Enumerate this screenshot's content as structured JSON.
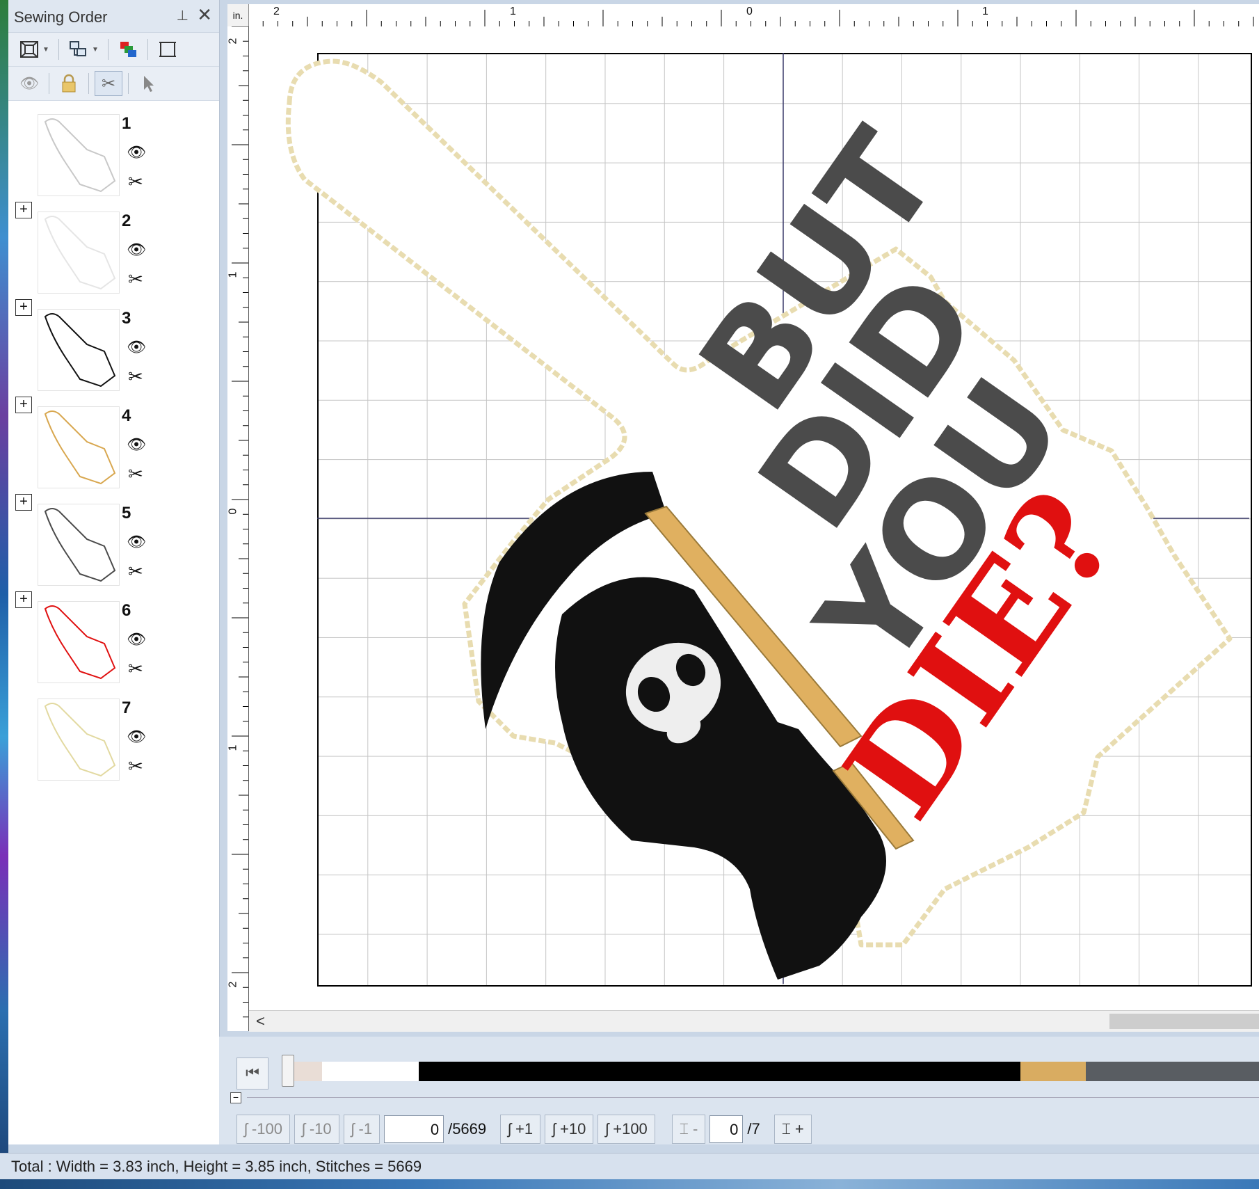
{
  "panel": {
    "title": "Sewing Order",
    "pin_icon": "pin-icon",
    "close_icon": "close-icon"
  },
  "toolbar": {
    "row1": [
      "fit-to-view-icon",
      "group-icon",
      "color-order-icon",
      "hoop-icon"
    ],
    "row2": [
      "visibility-icon",
      "lock-icon",
      "needle-icon",
      "select-arrow-icon"
    ]
  },
  "sewing_items": [
    {
      "num": "1",
      "expandable": false,
      "thumb_color": "#c8c8c8"
    },
    {
      "num": "2",
      "expandable": true,
      "thumb_color": "#e5e5e5"
    },
    {
      "num": "3",
      "expandable": true,
      "thumb_color": "#111111"
    },
    {
      "num": "4",
      "expandable": true,
      "thumb_color": "#d8a74f"
    },
    {
      "num": "5",
      "expandable": true,
      "thumb_color": "#4a4a4a"
    },
    {
      "num": "6",
      "expandable": true,
      "thumb_color": "#e01010"
    },
    {
      "num": "7",
      "expandable": false,
      "thumb_color": "#e2d9a0"
    }
  ],
  "ruler": {
    "unit": "in.",
    "top_labels": [
      "2",
      "1",
      "0",
      "1"
    ],
    "left_labels": [
      "2",
      "1",
      "0",
      "1",
      "2"
    ]
  },
  "design": {
    "line1": "BUT",
    "line2": "DID",
    "line3": "YOU",
    "line4": "DIE?",
    "colors": {
      "outline": "#e8dcb0",
      "text_gray": "#4b4b4b",
      "text_red": "#e01010",
      "cloak": "#111111",
      "handle": "#e0b060",
      "skull": "#eeeeee"
    }
  },
  "player": {
    "color_segments": [
      {
        "color": "#e9ddd6",
        "weight": 8
      },
      {
        "color": "#ffffff",
        "weight": 28
      },
      {
        "color": "#000000",
        "weight": 174
      },
      {
        "color": "#d9ac61",
        "weight": 19
      },
      {
        "color": "#595d62",
        "weight": 50
      }
    ],
    "buttons": {
      "minus100": "-100",
      "minus10": "-10",
      "minus1": "-1",
      "plus1": "+1",
      "plus10": "+10",
      "plus100": "+100",
      "color_minus": "-",
      "color_plus": "+"
    },
    "stitch_value": "0",
    "stitch_total": "/5669",
    "color_value": "0",
    "color_total": "/7"
  },
  "status": {
    "text": "Total : Width = 3.83 inch, Height = 3.85 inch, Stitches = 5669"
  }
}
